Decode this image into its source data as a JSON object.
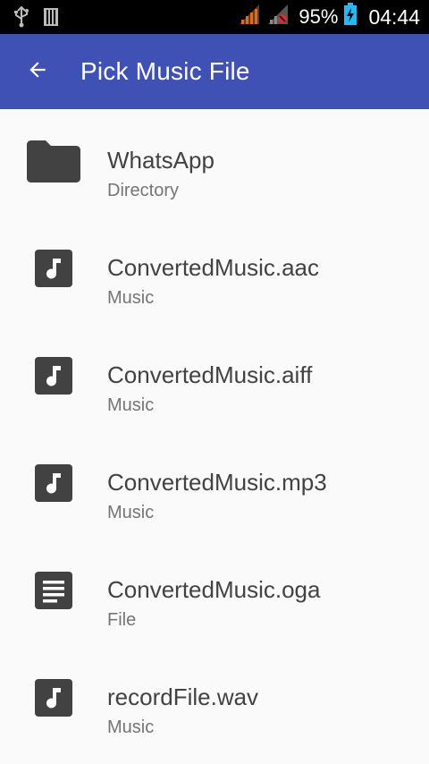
{
  "status_bar": {
    "battery_percent": "95%",
    "time": "04:44",
    "icons": [
      "usb-icon",
      "sim-card-icon",
      "signal-icon",
      "signal-no-data-icon",
      "battery-charging-icon"
    ]
  },
  "app_bar": {
    "title": "Pick Music File",
    "back_icon": "arrow-back-icon"
  },
  "files": [
    {
      "name": "WhatsApp",
      "type": "Directory",
      "icon": "folder-icon"
    },
    {
      "name": "ConvertedMusic.aac",
      "type": "Music",
      "icon": "music-note-icon"
    },
    {
      "name": "ConvertedMusic.aiff",
      "type": "Music",
      "icon": "music-note-icon"
    },
    {
      "name": "ConvertedMusic.mp3",
      "type": "Music",
      "icon": "music-note-icon"
    },
    {
      "name": "ConvertedMusic.oga",
      "type": "File",
      "icon": "document-icon"
    },
    {
      "name": "recordFile.wav",
      "type": "Music",
      "icon": "music-note-icon"
    }
  ],
  "colors": {
    "app_bar": "#3f51b5",
    "status_bar": "#000000",
    "background": "#fafafa",
    "icon": "#424242",
    "primary_text": "#424242",
    "secondary_text": "#757575"
  }
}
